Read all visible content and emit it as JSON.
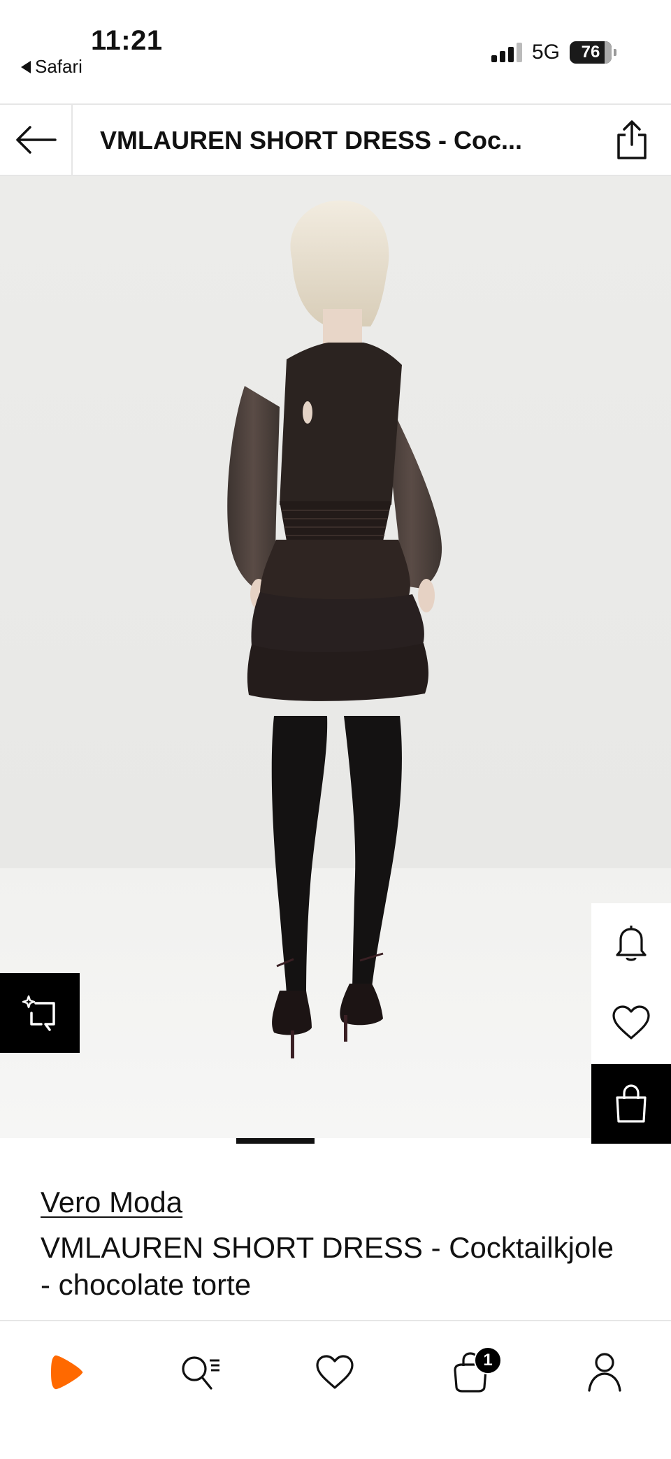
{
  "status_bar": {
    "time": "11:21",
    "back_app": "Safari",
    "network": "5G",
    "battery": "76"
  },
  "header": {
    "title": "VMLAUREN SHORT DRESS - Coc..."
  },
  "product": {
    "brand": "Vero Moda",
    "name": "VMLAUREN SHORT DRESS - Cocktailkjole - chocolate torte"
  },
  "gallery": {
    "current_index": 2,
    "total_images": 7
  },
  "bottom_nav": {
    "bag_count": "1"
  },
  "colors": {
    "accent": "#ff6900",
    "dark": "#000000",
    "divider": "#e6e6e6"
  },
  "icons": [
    "back-arrow-icon",
    "share-icon",
    "similar-items-icon",
    "bell-icon",
    "heart-icon",
    "shopping-bag-icon",
    "zalando-logo-icon",
    "search-icon",
    "wishlist-heart-icon",
    "cart-icon",
    "profile-icon"
  ]
}
